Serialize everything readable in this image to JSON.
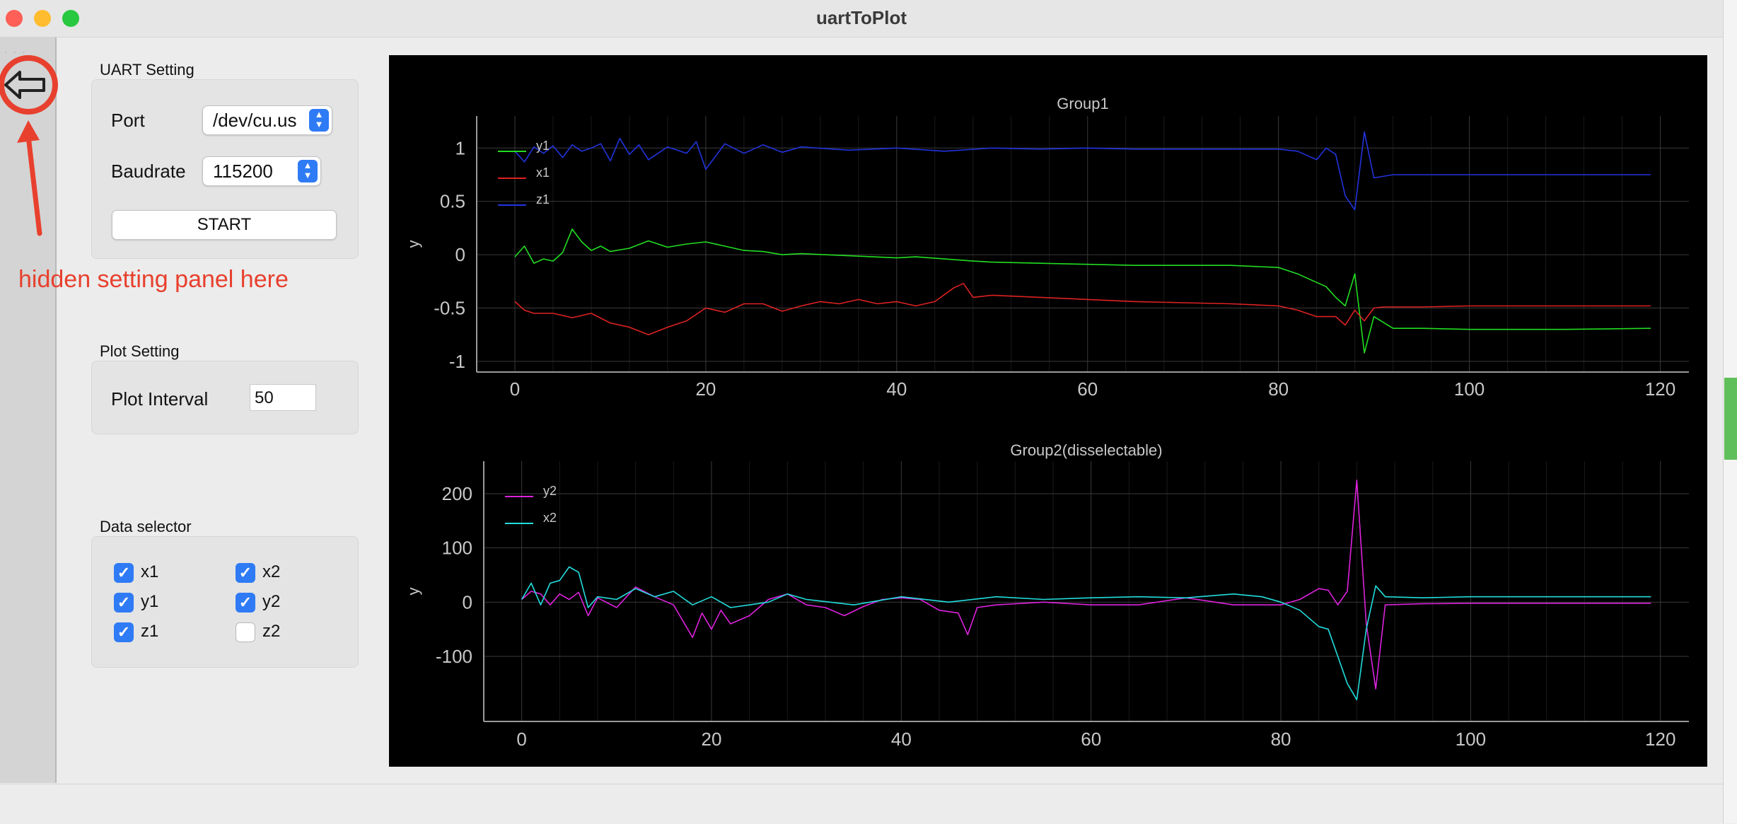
{
  "window": {
    "title": "uartToPlot"
  },
  "colors": {
    "close": "#fe5f57",
    "minimize": "#febc2e",
    "zoom": "#28c840",
    "accent": "#2f7bf5",
    "annotation": "#e8402e",
    "plot_bg": "#000000"
  },
  "uart_setting": {
    "title": "UART Setting",
    "port_label": "Port",
    "port_value": "/dev/cu.us",
    "baudrate_label": "Baudrate",
    "baudrate_value": "115200",
    "start_label": "START"
  },
  "plot_setting": {
    "title": "Plot Setting",
    "interval_label": "Plot Interval",
    "interval_value": "50"
  },
  "data_selector": {
    "title": "Data selector",
    "items": [
      {
        "label": "x1",
        "checked": true
      },
      {
        "label": "y1",
        "checked": true
      },
      {
        "label": "z1",
        "checked": true
      },
      {
        "label": "x2",
        "checked": true
      },
      {
        "label": "y2",
        "checked": true
      },
      {
        "label": "z2",
        "checked": false
      }
    ]
  },
  "annotation": {
    "text": "hidden setting panel here",
    "icon": "back-arrow-icon"
  },
  "chart_data": [
    {
      "type": "line",
      "title": "Group1",
      "xlabel": "",
      "ylabel": "y",
      "xlim": [
        -4,
        123
      ],
      "ylim": [
        -1.1,
        1.3
      ],
      "xticks": [
        0,
        20,
        40,
        60,
        80,
        100,
        120
      ],
      "yticks": [
        1,
        0.5,
        0,
        -0.5,
        -1
      ],
      "ytick_labels": [
        "1",
        "0.5",
        "0",
        "-0.5",
        "-1"
      ],
      "grid": true,
      "legend": "top-left",
      "series": [
        {
          "name": "y1",
          "color": "#22dd22",
          "x": [
            0,
            1,
            2,
            3,
            4,
            5,
            6,
            7,
            8,
            9,
            10,
            12,
            14,
            16,
            18,
            20,
            22,
            24,
            26,
            28,
            30,
            35,
            40,
            42,
            45,
            48,
            50,
            55,
            60,
            65,
            70,
            75,
            80,
            82,
            84,
            85,
            86,
            87,
            88,
            89,
            90,
            92,
            95,
            100,
            110,
            119
          ],
          "y": [
            -0.02,
            0.08,
            -0.08,
            -0.04,
            -0.06,
            0.02,
            0.24,
            0.12,
            0.04,
            0.08,
            0.03,
            0.06,
            0.13,
            0.07,
            0.1,
            0.12,
            0.08,
            0.04,
            0.03,
            0.0,
            0.01,
            -0.01,
            -0.03,
            -0.02,
            -0.04,
            -0.06,
            -0.07,
            -0.08,
            -0.09,
            -0.1,
            -0.1,
            -0.1,
            -0.12,
            -0.18,
            -0.26,
            -0.3,
            -0.4,
            -0.48,
            -0.18,
            -0.92,
            -0.58,
            -0.69,
            -0.69,
            -0.7,
            -0.7,
            -0.69
          ]
        },
        {
          "name": "x1",
          "color": "#dd2222",
          "x": [
            0,
            1,
            2,
            4,
            6,
            8,
            10,
            12,
            14,
            16,
            18,
            20,
            22,
            24,
            26,
            28,
            30,
            32,
            34,
            36,
            38,
            40,
            42,
            44,
            46,
            47,
            48,
            50,
            55,
            60,
            65,
            70,
            75,
            80,
            82,
            84,
            86,
            87,
            88,
            89,
            90,
            91,
            95,
            100,
            110,
            119
          ],
          "y": [
            -0.44,
            -0.52,
            -0.55,
            -0.55,
            -0.59,
            -0.55,
            -0.64,
            -0.68,
            -0.75,
            -0.68,
            -0.62,
            -0.5,
            -0.54,
            -0.46,
            -0.46,
            -0.53,
            -0.48,
            -0.44,
            -0.46,
            -0.42,
            -0.46,
            -0.44,
            -0.48,
            -0.44,
            -0.31,
            -0.27,
            -0.4,
            -0.38,
            -0.4,
            -0.42,
            -0.44,
            -0.45,
            -0.46,
            -0.48,
            -0.52,
            -0.58,
            -0.58,
            -0.66,
            -0.52,
            -0.62,
            -0.5,
            -0.49,
            -0.49,
            -0.48,
            -0.48,
            -0.48
          ]
        },
        {
          "name": "z1",
          "color": "#2233dd",
          "x": [
            0,
            1,
            2,
            3,
            4,
            5,
            6,
            7,
            8,
            9,
            10,
            11,
            12,
            13,
            14,
            16,
            18,
            19,
            20,
            22,
            24,
            26,
            28,
            30,
            35,
            40,
            45,
            50,
            55,
            60,
            65,
            70,
            75,
            80,
            82,
            84,
            85,
            86,
            87,
            88,
            89,
            90,
            92,
            95,
            100,
            110,
            119
          ],
          "y": [
            0.97,
            0.87,
            1.01,
            0.95,
            1.02,
            0.91,
            1.03,
            0.97,
            1.0,
            1.04,
            0.88,
            1.09,
            0.94,
            1.03,
            0.89,
            1.01,
            0.95,
            1.06,
            0.8,
            1.04,
            0.95,
            1.03,
            0.96,
            1.01,
            0.98,
            1.0,
            0.97,
            1.0,
            0.99,
            1.0,
            0.99,
            0.99,
            0.99,
            0.99,
            0.97,
            0.89,
            1.0,
            0.94,
            0.55,
            0.42,
            1.15,
            0.72,
            0.75,
            0.75,
            0.75,
            0.75,
            0.75
          ]
        }
      ]
    },
    {
      "type": "line",
      "title": "Group2(disselectable)",
      "xlabel": "",
      "ylabel": "y",
      "xlim": [
        -4,
        123
      ],
      "ylim": [
        -220,
        260
      ],
      "xticks": [
        0,
        20,
        40,
        60,
        80,
        100,
        120
      ],
      "yticks": [
        200,
        100,
        0,
        -100
      ],
      "ytick_labels": [
        "200",
        "100",
        "0",
        "-100"
      ],
      "grid": true,
      "legend": "top-left",
      "series": [
        {
          "name": "y2",
          "color": "#dd22dd",
          "x": [
            0,
            1,
            2,
            3,
            4,
            5,
            6,
            7,
            8,
            10,
            12,
            14,
            16,
            18,
            19,
            20,
            21,
            22,
            24,
            26,
            28,
            30,
            32,
            34,
            36,
            38,
            40,
            42,
            44,
            46,
            47,
            48,
            50,
            55,
            60,
            65,
            70,
            75,
            80,
            82,
            84,
            85,
            86,
            87,
            88,
            89,
            90,
            91,
            95,
            100,
            110,
            119
          ],
          "y": [
            5,
            20,
            15,
            -5,
            15,
            5,
            18,
            -25,
            8,
            -10,
            28,
            10,
            -5,
            -65,
            -20,
            -50,
            -15,
            -40,
            -25,
            5,
            15,
            -5,
            -10,
            -25,
            -8,
            5,
            8,
            5,
            -15,
            -20,
            -60,
            -10,
            -5,
            0,
            -5,
            -5,
            8,
            -5,
            -5,
            5,
            25,
            22,
            -5,
            20,
            225,
            -40,
            -160,
            -5,
            -3,
            -2,
            -2,
            -2
          ]
        },
        {
          "name": "x2",
          "color": "#22dddd",
          "x": [
            0,
            1,
            2,
            3,
            4,
            5,
            6,
            7,
            8,
            10,
            12,
            14,
            16,
            18,
            20,
            22,
            24,
            26,
            28,
            30,
            35,
            40,
            45,
            50,
            55,
            60,
            65,
            70,
            75,
            78,
            80,
            82,
            84,
            85,
            86,
            87,
            88,
            89,
            90,
            91,
            95,
            100,
            110,
            119
          ],
          "y": [
            5,
            35,
            -5,
            35,
            40,
            65,
            55,
            -10,
            10,
            5,
            25,
            10,
            20,
            -5,
            10,
            -10,
            -5,
            0,
            15,
            5,
            -5,
            10,
            0,
            10,
            5,
            8,
            10,
            8,
            15,
            10,
            0,
            -15,
            -45,
            -50,
            -100,
            -150,
            -180,
            -50,
            30,
            10,
            8,
            10,
            10,
            10
          ]
        }
      ]
    }
  ]
}
